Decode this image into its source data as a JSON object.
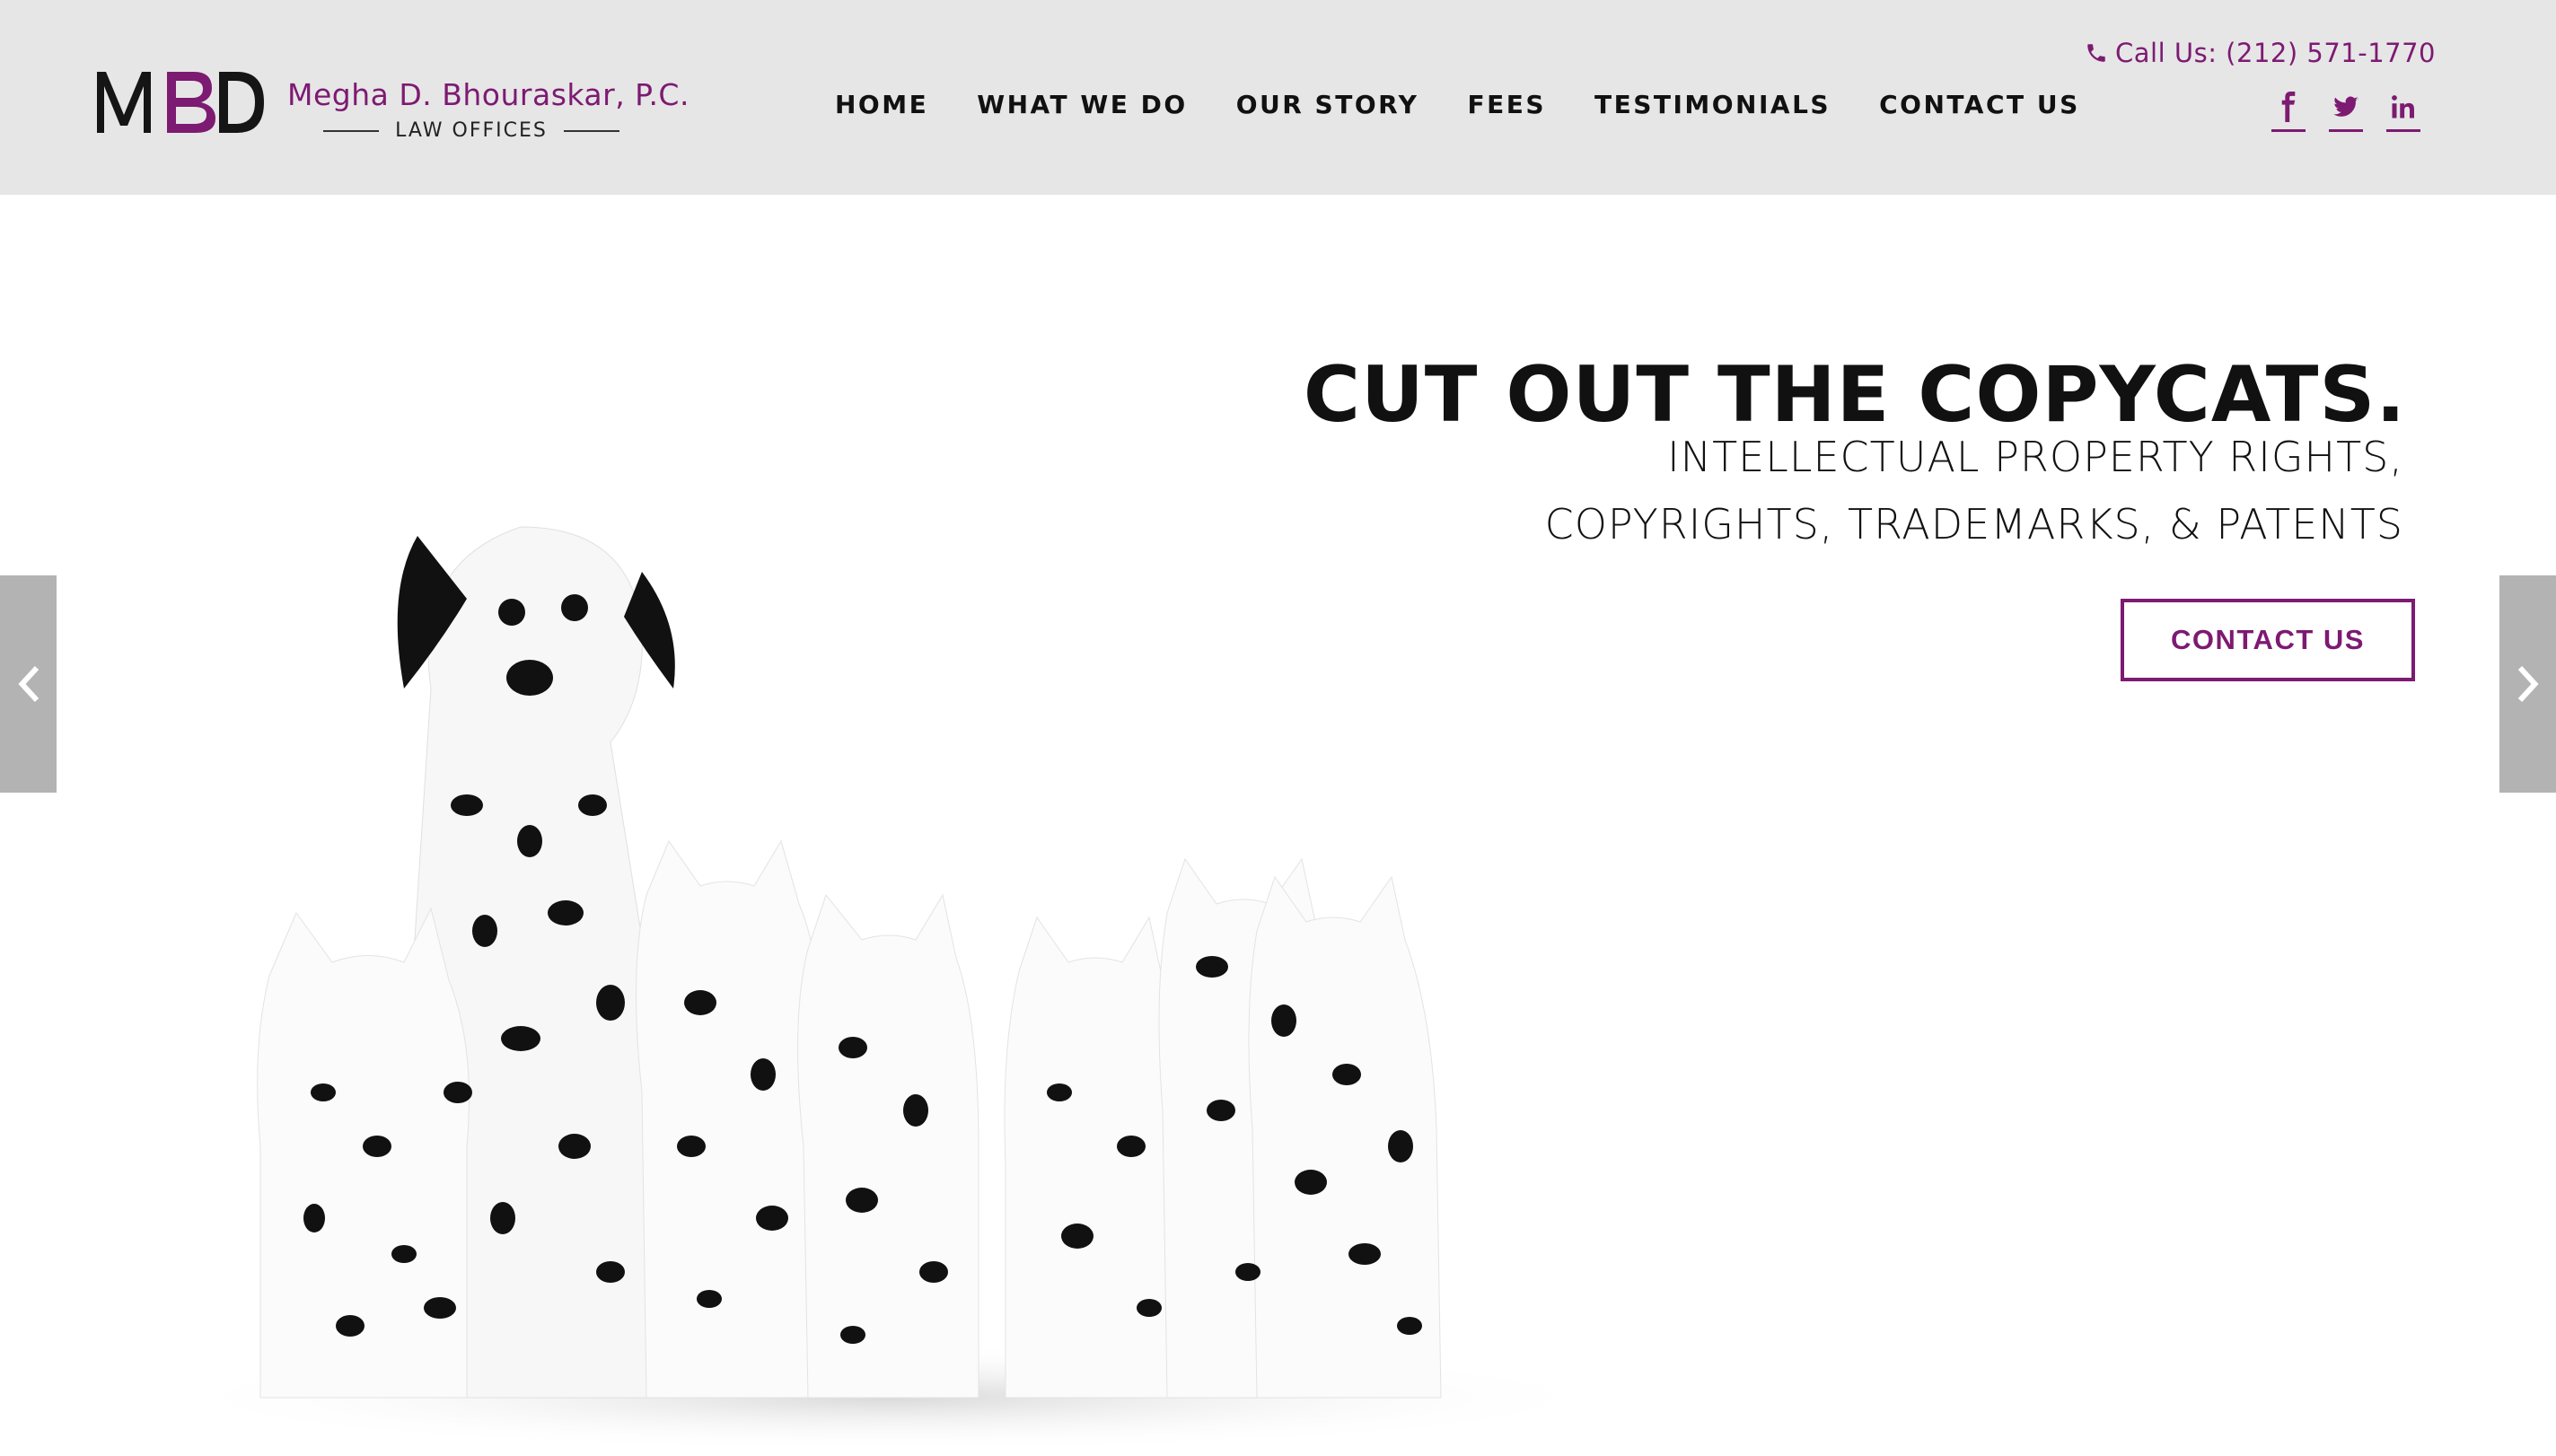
{
  "brand": {
    "name": "Megha D. Bhouraskar, P.C.",
    "subtitle": "LAW OFFICES",
    "accent_color": "#7d1a72",
    "logo_letters": "MBD"
  },
  "nav": {
    "items": [
      {
        "label": "HOME"
      },
      {
        "label": "WHAT WE DO"
      },
      {
        "label": "OUR STORY"
      },
      {
        "label": "FEES"
      },
      {
        "label": "TESTIMONIALS"
      },
      {
        "label": "CONTACT US"
      }
    ]
  },
  "header_contact": {
    "call_text": "Call Us: (212) 571-1770",
    "icon": "phone-icon"
  },
  "social": [
    {
      "name": "facebook",
      "icon": "facebook-icon"
    },
    {
      "name": "twitter",
      "icon": "twitter-icon"
    },
    {
      "name": "linkedin",
      "icon": "linkedin-icon"
    }
  ],
  "hero": {
    "headline": "CUT OUT THE COPYCATS.",
    "sub_lines": [
      "INTELLECTUAL PROPERTY RIGHTS,",
      "COPYRIGHTS, TRADEMARKS, & PATENTS"
    ],
    "cta_label": "CONTACT US",
    "image_alt": "Dalmatian dog sitting among white cats with dalmatian spots",
    "prev_icon": "chevron-left-icon",
    "next_icon": "chevron-right-icon"
  }
}
